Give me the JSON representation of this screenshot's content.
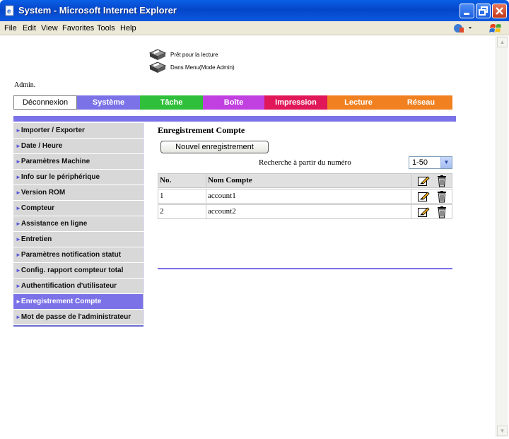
{
  "window": {
    "title": "System - Microsoft Internet Explorer"
  },
  "menu": [
    "File",
    "Edit",
    "View",
    "Favorites",
    "Tools",
    "Help"
  ],
  "status": {
    "line1": "Prêt pour la lecture",
    "line2": "Dans Menu(Mode Admin)"
  },
  "admin_label": "Admin.",
  "tabs": {
    "logout": "Déconnexion",
    "items": [
      {
        "label": "Système",
        "color": "#7b72e8"
      },
      {
        "label": "Tâche",
        "color": "#2fbf3a"
      },
      {
        "label": "Boîte",
        "color": "#c040e0"
      },
      {
        "label": "Impression",
        "color": "#e0185a"
      },
      {
        "label": "Lecture",
        "color": "#f08020"
      },
      {
        "label": "Réseau",
        "color": "#f08020"
      }
    ]
  },
  "sidebar": {
    "items": [
      {
        "label": "Importer / Exporter"
      },
      {
        "label": "Date / Heure"
      },
      {
        "label": "Paramètres Machine"
      },
      {
        "label": "Info sur le périphérique"
      },
      {
        "label": "Version ROM"
      },
      {
        "label": "Compteur"
      },
      {
        "label": "Assistance en ligne"
      },
      {
        "label": "Entretien"
      },
      {
        "label": "Paramètres notification statut"
      },
      {
        "label": "Config. rapport compteur total"
      },
      {
        "label": "Authentification d'utilisateur"
      },
      {
        "label": "Enregistrement Compte",
        "active": true
      },
      {
        "label": "Mot de passe de l'administrateur"
      }
    ]
  },
  "content": {
    "title": "Enregistrement Compte",
    "new_button": "Nouvel enregistrement",
    "search_label": "Recherche à partir du numéro",
    "range_value": "1-50",
    "table": {
      "headers": {
        "no": "No.",
        "name": "Nom Compte"
      },
      "rows": [
        {
          "no": "1",
          "name": "account1"
        },
        {
          "no": "2",
          "name": "account2"
        }
      ]
    }
  }
}
